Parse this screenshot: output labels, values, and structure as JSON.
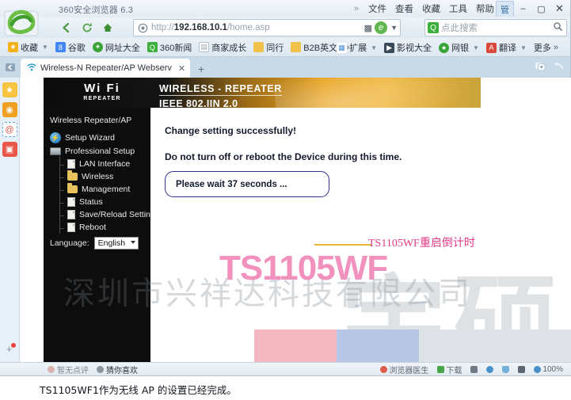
{
  "browser": {
    "title": "360安全浏览器 6.3",
    "menu": [
      "文件",
      "查看",
      "收藏",
      "工具",
      "帮助"
    ],
    "window_controls": [
      "管",
      "–",
      "▢",
      "✕"
    ],
    "nav_buttons": [
      "back-arrow",
      "refresh",
      "home"
    ],
    "address": {
      "scheme": "http://",
      "host": "192.168.10.1",
      "path": "/home.asp"
    },
    "search": {
      "placeholder": "点此搜索"
    },
    "bookmarks_left": [
      {
        "label": "收藏",
        "icon": "star-icon",
        "color": "#f5b21a",
        "glyph": "★",
        "caret": true
      },
      {
        "label": "谷歌",
        "icon": "google-icon",
        "color": "#4285f4",
        "glyph": "8",
        "caret": false
      },
      {
        "label": "网址大全",
        "icon": "nav-site-icon",
        "color": "#3aa33a",
        "glyph": "✦",
        "caret": false
      },
      {
        "label": "360新闻",
        "icon": "search-green-icon",
        "color": "#3cb03c",
        "glyph": "Q",
        "caret": false
      },
      {
        "label": "商家成长",
        "icon": "page-icon",
        "color": "#ffffff",
        "glyph": "▤",
        "caret": false
      },
      {
        "label": "同行",
        "icon": "folder-icon",
        "color": "#f0c24b",
        "glyph": "",
        "caret": false
      },
      {
        "label": "B2B英文",
        "icon": "folder-icon",
        "color": "#f0c24b",
        "glyph": "",
        "caret": false
      }
    ],
    "bookmarks_more": "»",
    "bookmarks_right": [
      {
        "label": "扩展",
        "icon": "extension-icon",
        "color": "#4a90d9",
        "glyph": "▦",
        "caret": true
      },
      {
        "label": "影视大全",
        "icon": "video-icon",
        "color": "#3b4a5a",
        "glyph": "▶",
        "caret": false
      },
      {
        "label": "网银",
        "icon": "bank-icon",
        "color": "#3aa33a",
        "glyph": "●",
        "caret": true
      },
      {
        "label": "翻译",
        "icon": "translate-icon",
        "color": "#d94a3d",
        "glyph": "A",
        "caret": true
      },
      {
        "label": "更多",
        "icon": "more-icon",
        "color": "",
        "glyph": "",
        "caret": false
      }
    ],
    "tab": {
      "title": "Wireless-N Repeater/AP Webserv",
      "close": "✕",
      "new_tab": "+"
    },
    "rail_icons": [
      {
        "name": "favorites-star-icon",
        "glyph": "★",
        "color": "#f7c442"
      },
      {
        "name": "weibo-icon",
        "glyph": "◉",
        "color": "#f0a020"
      },
      {
        "name": "email-icon",
        "glyph": "@",
        "color": "#ffffff"
      },
      {
        "name": "shopping-bag-icon",
        "glyph": "▣",
        "color": "#e8574a"
      }
    ],
    "status_left": [
      {
        "label": "暂无点评",
        "icon": "comment-icon",
        "color": "#c9a6a0",
        "dim": true
      },
      {
        "label": "猜你喜欢",
        "icon": "bullet-icon",
        "color": "#8c969f",
        "dim": false
      }
    ],
    "status_right": [
      {
        "label": "浏览器医生",
        "icon": "doctor-icon",
        "color": "#e05c4a"
      },
      {
        "label": "下载",
        "icon": "download-icon",
        "color": "#4aa54a"
      },
      {
        "label": "",
        "icon": "flag-icon",
        "color": "#707a85"
      },
      {
        "label": "",
        "icon": "globe-icon",
        "color": "#4a90c8"
      },
      {
        "label": "",
        "icon": "shield-icon",
        "color": "#4a90c8"
      },
      {
        "label": "",
        "icon": "speaker-icon",
        "color": "#5a6672"
      },
      {
        "label": "100%",
        "icon": "zoom-icon",
        "color": "#4a90c8"
      }
    ]
  },
  "router": {
    "brand": {
      "logo_main": "Wi Fi",
      "logo_sub": "REPEATER",
      "header_line1": "WIRELESS - REPEATER",
      "header_line2": "IEEE 802.IIN 2.0"
    },
    "sidebar": {
      "title": "Wireless Repeater/AP",
      "items": [
        {
          "label": "Setup Wizard",
          "icon": "wizard-icon",
          "level": "lvl0"
        },
        {
          "label": "Professional Setup",
          "icon": "device-icon",
          "level": "lvl1"
        },
        {
          "label": "LAN Interface",
          "icon": "file-icon",
          "level": "sub"
        },
        {
          "label": "Wireless",
          "icon": "folder-icon",
          "level": "sub"
        },
        {
          "label": "Management",
          "icon": "folder-icon",
          "level": "sub"
        },
        {
          "label": "Status",
          "icon": "file-icon",
          "level": "sub"
        },
        {
          "label": "Save/Reload Settings",
          "icon": "file-icon",
          "level": "sub"
        },
        {
          "label": "Reboot",
          "icon": "file-icon",
          "level": "sub"
        }
      ],
      "language_label": "Language:",
      "language_value": "English"
    },
    "main": {
      "message_success": "Change setting successfully!",
      "message_warning": "Do not turn off or reboot the Device during this time.",
      "wait_text": "Please wait 37 seconds ..."
    }
  },
  "annotations": {
    "countdown_note": "TS1105WF重启倒计时",
    "model_watermark": "TS1105WF",
    "company_watermark": "深圳市兴祥达科技有限公司",
    "big_watermark": "宇硕"
  },
  "caption": {
    "text": "TS1105WF1作为无线 AP 的设置已经完成。"
  }
}
